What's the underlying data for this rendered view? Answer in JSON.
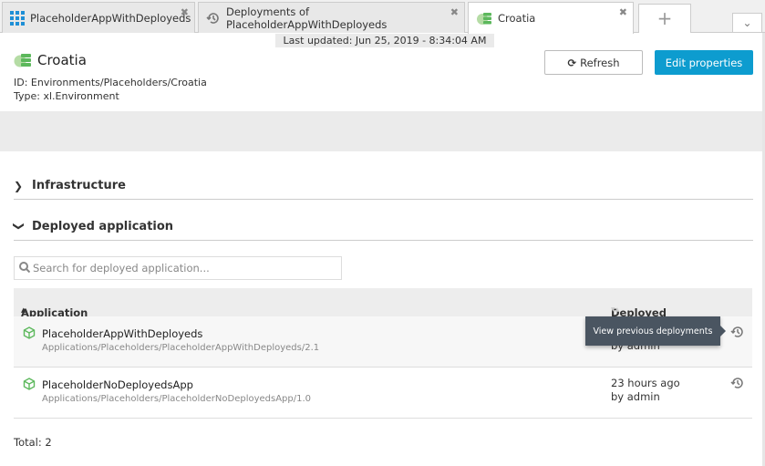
{
  "tabs": [
    {
      "label": "PlaceholderAppWithDeployeds",
      "icon": "grid-icon"
    },
    {
      "label": "Deployments of PlaceholderAppWithDeployeds",
      "icon": "history-icon"
    },
    {
      "label": "Croatia",
      "icon": "environment-icon",
      "active": true
    }
  ],
  "last_updated": "Last updated: Jun 25, 2019 - 8:34:04 AM",
  "header": {
    "title": "Croatia",
    "id": "ID: Environments/Placeholders/Croatia",
    "type": "Type: xl.Environment",
    "refresh_label": "Refresh",
    "edit_label": "Edit properties"
  },
  "sections": {
    "infrastructure": "Infrastructure",
    "deployed": "Deployed application"
  },
  "search": {
    "placeholder": "Search for deployed application..."
  },
  "table": {
    "col_app": "Application",
    "col_deployed": "Deployed",
    "rows": [
      {
        "name": "PlaceholderAppWithDeployeds",
        "path": "Applications/Placeholders/PlaceholderAppWithDeployeds/2.1",
        "time": "",
        "by": "by admin"
      },
      {
        "name": "PlaceholderNoDeployedsApp",
        "path": "Applications/Placeholders/PlaceholderNoDeployedsApp/1.0",
        "time": "23 hours ago",
        "by": "by admin"
      }
    ]
  },
  "tooltip": "View previous deployments",
  "total": "Total: 2",
  "colors": {
    "accent": "#0d9ccf",
    "app_icon": "#5cb85c",
    "env_icon": "#6abf4b"
  }
}
